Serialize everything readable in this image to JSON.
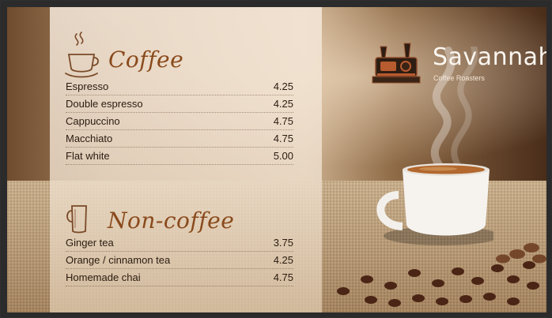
{
  "brand": {
    "name": "Savannah",
    "subtitle": "Coffee Roasters",
    "icon": "coffee-roaster-icon"
  },
  "sections": [
    {
      "title": "Coffee",
      "icon": "steaming-cup-icon",
      "items": [
        {
          "name": "Espresso",
          "price": "4.25"
        },
        {
          "name": "Double espresso",
          "price": "4.25"
        },
        {
          "name": "Cappuccino",
          "price": "4.75"
        },
        {
          "name": "Macchiato",
          "price": "4.75"
        },
        {
          "name": "Flat white",
          "price": "5.00"
        }
      ]
    },
    {
      "title": "Non-coffee",
      "icon": "mug-icon",
      "items": [
        {
          "name": "Ginger tea",
          "price": "3.75"
        },
        {
          "name": "Orange / cinnamon tea",
          "price": "4.25"
        },
        {
          "name": "Homemade chai",
          "price": "4.75"
        }
      ]
    }
  ],
  "colors": {
    "title": "#8a4a1c",
    "text": "#2a1b10",
    "brand_text": "#fbf6f0"
  }
}
